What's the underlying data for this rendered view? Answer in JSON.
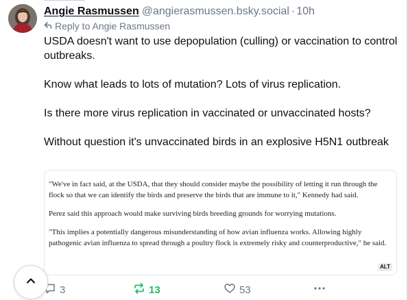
{
  "post": {
    "author_name": "Angie Rasmussen",
    "author_handle": "@angierasmussen.bsky.social",
    "separator": "·",
    "time": "10h",
    "reply_to": "Reply to Angie Rasmussen",
    "paragraphs": [
      "USDA doesn't want to use depopulation (culling) or vaccination to control outbreaks.",
      "Know what leads to lots of mutation? Lots of virus replication.",
      "Is there more virus replication in vaccinated or unvaccinated hosts?",
      "Without question it's unvaccinated birds in an explosive H5N1 outbreak"
    ]
  },
  "embed_image": {
    "paragraphs": [
      "\"We've in fact said, at the USDA, that they should consider maybe the possibility of letting it run through the flock so that we can identify the birds and preserve the birds that are immune to it,\" Kennedy had said.",
      "Perez said this approach would make surviving birds breeding grounds for worrying mutations.",
      "\"This implies a potentially dangerous misunderstanding of how avian influenza works. Allowing highly pathogenic avian influenza to spread through a poultry flock is extremely risky and counterproductive,\" he said."
    ],
    "alt_badge": "ALT"
  },
  "actions": {
    "reply_count": "3",
    "repost_count": "13",
    "like_count": "53"
  },
  "colors": {
    "text": "#0b0f14",
    "muted": "#6b7785",
    "repost_active": "#20bc6a",
    "border": "#e3e7ec"
  },
  "icons": {
    "reply": "reply-arrow-icon",
    "comment": "speech-bubble-icon",
    "repost": "repost-icon",
    "like": "heart-icon",
    "more": "ellipsis-icon",
    "scroll_top": "chevron-up-icon"
  }
}
